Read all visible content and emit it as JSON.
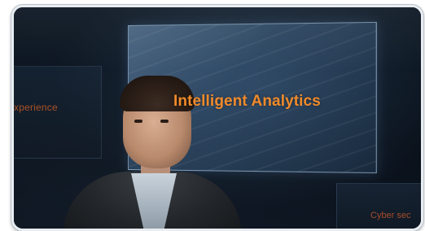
{
  "scene": {
    "main_panel_title": "Intelligent Analytics",
    "left_panel_text": "xperience",
    "right_panel_text": "Cyber sec"
  },
  "colors": {
    "accent_orange": "#f08a2a",
    "background": "#07101a",
    "frame": "#e9edf1"
  }
}
